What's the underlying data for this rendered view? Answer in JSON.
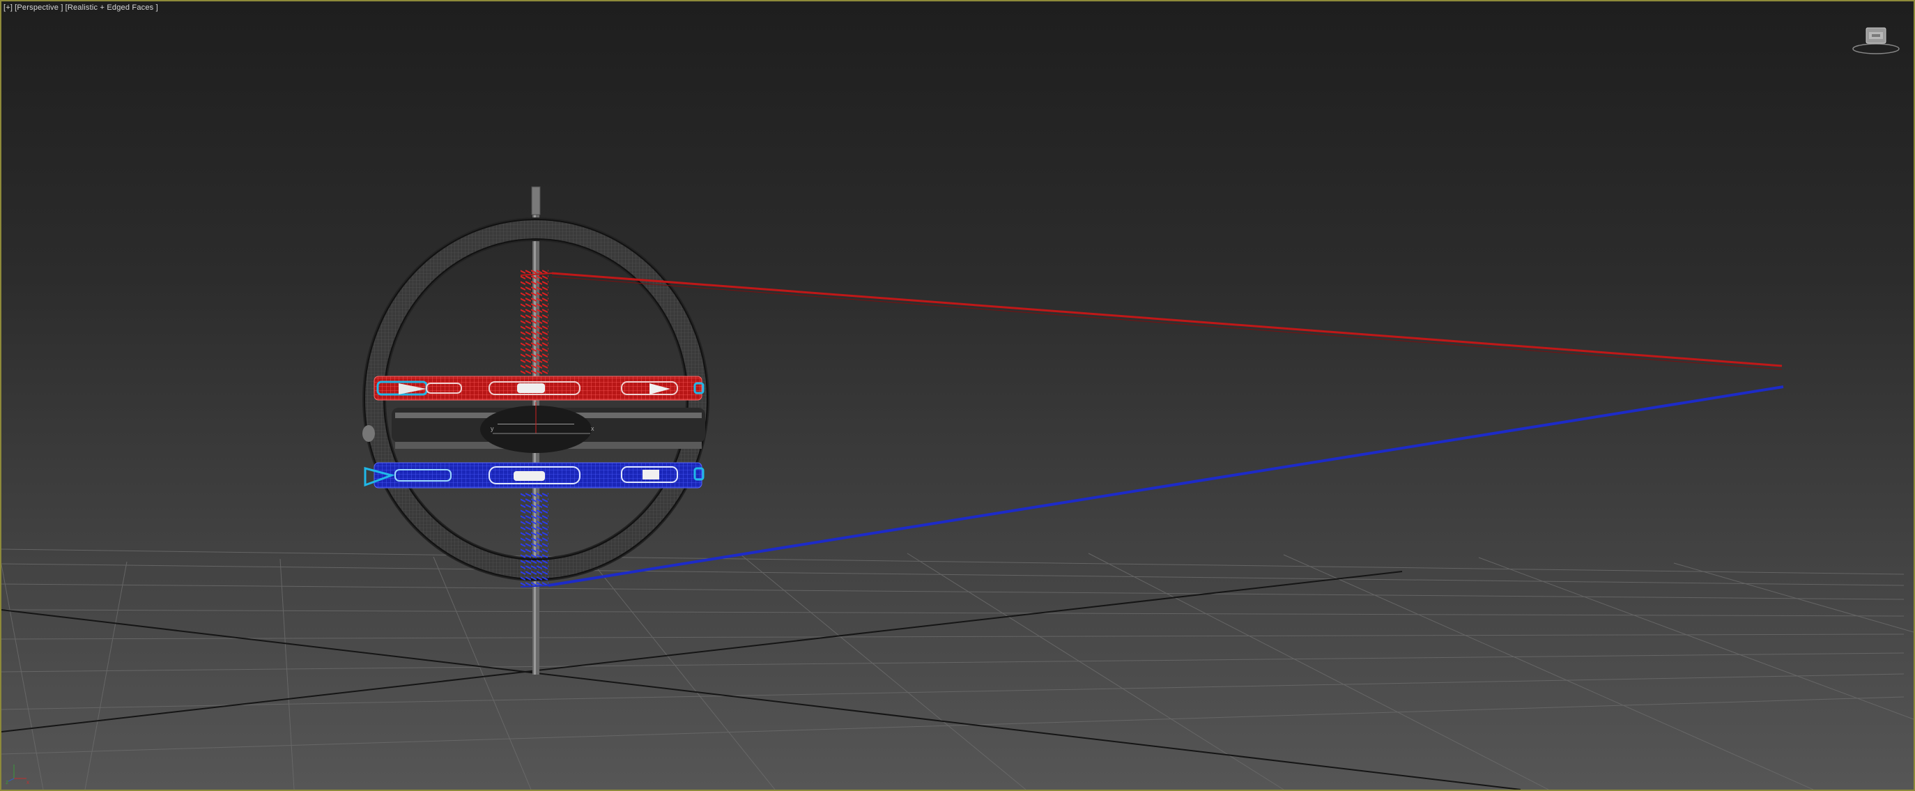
{
  "viewport": {
    "menu_label": "[+]",
    "view_label": "[Perspective ]",
    "shading_label": "[Realistic + Edged Faces ]",
    "frame_color": "#8e8a3a"
  },
  "scene": {
    "model": "gimbal-spring-assembly",
    "red_color": "#d01818",
    "blue_color": "#1d2bd8",
    "cyan_color": "#20b8e8"
  },
  "gizmo": {
    "x_label": "x",
    "y_label": "y"
  },
  "axis_tripod": {
    "x_label": "x",
    "z_label": "z"
  },
  "viewcube": {
    "icon": "viewcube-icon"
  }
}
